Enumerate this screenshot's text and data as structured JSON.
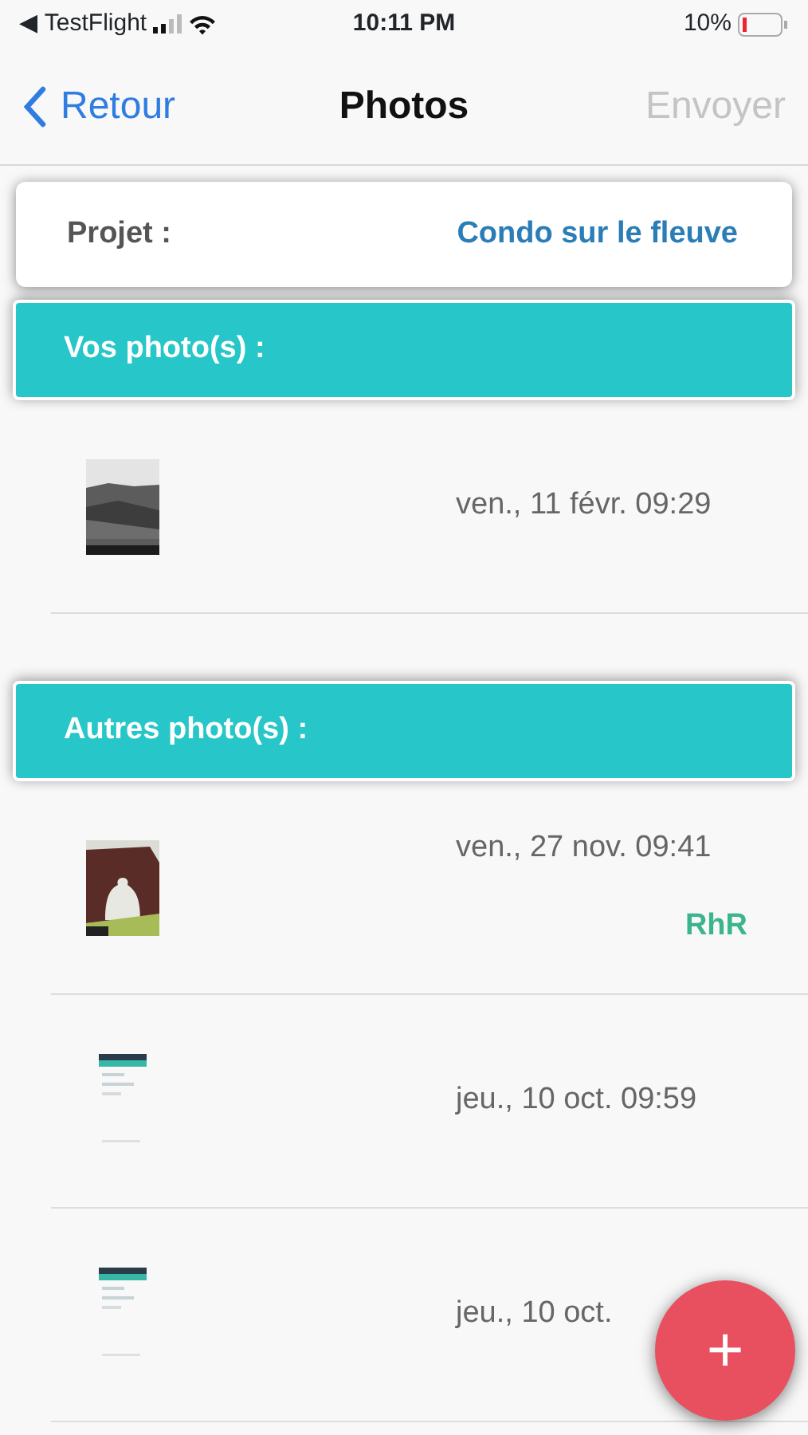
{
  "status_bar": {
    "back_app": "◀ TestFlight",
    "time": "10:11 PM",
    "battery": "10%"
  },
  "nav": {
    "back": "Retour",
    "title": "Photos",
    "action": {
      "label": "Envoyer",
      "disabled": true
    }
  },
  "project": {
    "label": "Projet :",
    "value": "Condo sur le fleuve"
  },
  "sections": [
    {
      "title": "Vos photo(s) :",
      "items": [
        {
          "kind": "picture",
          "date": "ven., 11 févr. 09:29"
        }
      ]
    },
    {
      "title": "Autres photo(s) :",
      "items": [
        {
          "kind": "picture",
          "date": "ven., 27 nov. 09:41",
          "author": "RhR"
        },
        {
          "kind": "picture",
          "date": "jeu., 10 oct. 09:59"
        },
        {
          "kind": "picture",
          "date": "jeu., 10 oct."
        }
      ]
    }
  ],
  "fab": "+"
}
